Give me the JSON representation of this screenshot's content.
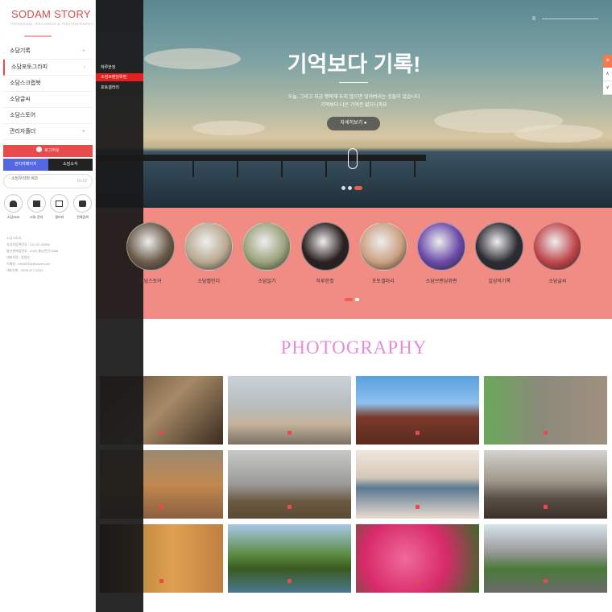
{
  "logo": {
    "text": "SODAM STORY",
    "sub": "PERSONAL RECORDS & PHOTOGRAPHY"
  },
  "menu": [
    {
      "label": "소담기록",
      "arrow": "+"
    },
    {
      "label": "소담포토그라피",
      "arrow": "›"
    },
    {
      "label": "소담스크랩북",
      "arrow": ""
    },
    {
      "label": "소담글씨",
      "arrow": ""
    },
    {
      "label": "소담스토어",
      "arrow": ""
    },
    {
      "label": "관리자폴더",
      "arrow": "+"
    }
  ],
  "login_label": "로그아웃",
  "tabs": [
    "관리자페이지",
    "소담소식"
  ],
  "notice": {
    "text": "· 소담우라라 #03",
    "date": "16-12"
  },
  "quick": [
    "소담SNS",
    "1대1 문의",
    "갤러리",
    "전체검색"
  ],
  "info": [
    "소담스토리",
    "사업자등록번호 : 311-02-33456",
    "통신판매업번호 : 2015-충남천안-0086",
    "대표자명 : 정영순",
    "이메일 : mind2002@naver.com",
    "대표전화 : 0505-417-5323"
  ],
  "submenu": [
    "하루한컷",
    "소담브랜딩위편",
    "포토갤러리"
  ],
  "hero": {
    "title": "기억보다 기록!",
    "desc1": "오늘, 그리고 지금 행복해 두지 않으면 잊어버리는 것들이 있습니다",
    "desc2": "기억보다 나은 기억은 없으니까요",
    "button": "자세히보기",
    "pause": "II"
  },
  "side": {
    "top": "≡",
    "up": "∧",
    "down": "∨"
  },
  "categories": [
    "소담스토어",
    "소담캘린더",
    "소담일기",
    "하루한컷",
    "포토갤러리",
    "소담브랜딩위편",
    "일상의기록",
    "소담글씨"
  ],
  "photo_title": "PHOTOGRAPHY",
  "colors": {
    "accent": "#e94b4b",
    "band": "#f08c84",
    "title": "#e88ad9",
    "tab_blue": "#5567e3"
  }
}
